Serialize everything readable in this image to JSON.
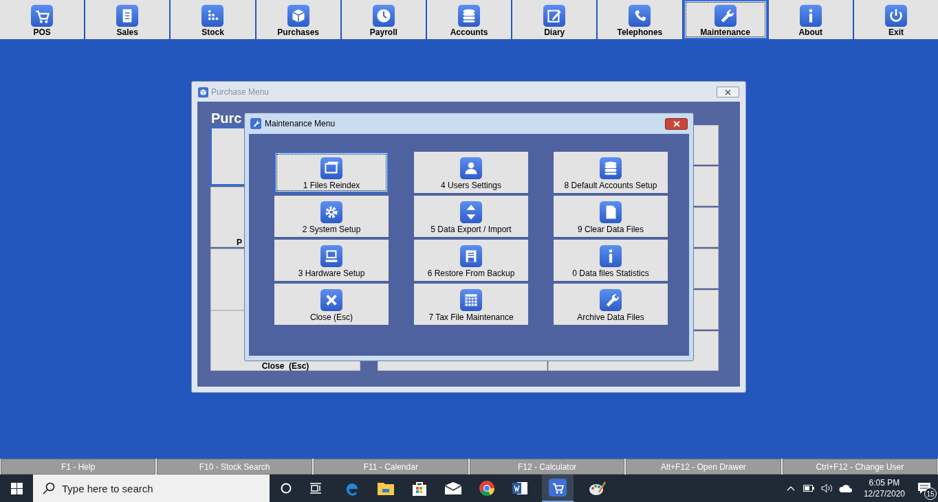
{
  "toolbar": [
    {
      "label": "POS",
      "selected": false
    },
    {
      "label": "Sales",
      "selected": false
    },
    {
      "label": "Stock",
      "selected": false
    },
    {
      "label": "Purchases",
      "selected": false
    },
    {
      "label": "Payroll",
      "selected": false
    },
    {
      "label": "Accounts",
      "selected": false
    },
    {
      "label": "Diary",
      "selected": false
    },
    {
      "label": "Telephones",
      "selected": false
    },
    {
      "label": "Maintenance",
      "selected": true
    },
    {
      "label": "About",
      "selected": false
    },
    {
      "label": "Exit",
      "selected": false
    }
  ],
  "purchase_window": {
    "title": "Purchase Menu",
    "heading": "Purc",
    "fragment": "P",
    "close_label": "Close  (Esc)"
  },
  "maintenance_window": {
    "title": "Maintenance Menu",
    "tiles": [
      {
        "label": "1 Files Reindex",
        "selected": true
      },
      {
        "label": "4 Users Settings",
        "selected": false
      },
      {
        "label": "8 Default Accounts Setup",
        "selected": false
      },
      {
        "label": "2 System Setup",
        "selected": false
      },
      {
        "label": "5 Data Export / Import",
        "selected": false
      },
      {
        "label": "9 Clear Data Files",
        "selected": false
      },
      {
        "label": "3 Hardware Setup",
        "selected": false
      },
      {
        "label": "6 Restore From Backup",
        "selected": false
      },
      {
        "label": "0 Data files Statistics",
        "selected": false
      },
      {
        "label": "Close (Esc)",
        "selected": false
      },
      {
        "label": "7 Tax File Maintenance",
        "selected": false
      },
      {
        "label": "Archive Data Files",
        "selected": false
      }
    ]
  },
  "function_bar": [
    "F1 - Help",
    "F10 - Stock Search",
    "F11 - Calendar",
    "F12 - Calculator",
    "Alt+F12 - Open Drawer",
    "Ctrl+F12 - Change User"
  ],
  "taskbar": {
    "search": {
      "placeholder": "Type here to search"
    },
    "time": "6:05 PM",
    "date": "12/27/2020",
    "notifications": "15"
  }
}
